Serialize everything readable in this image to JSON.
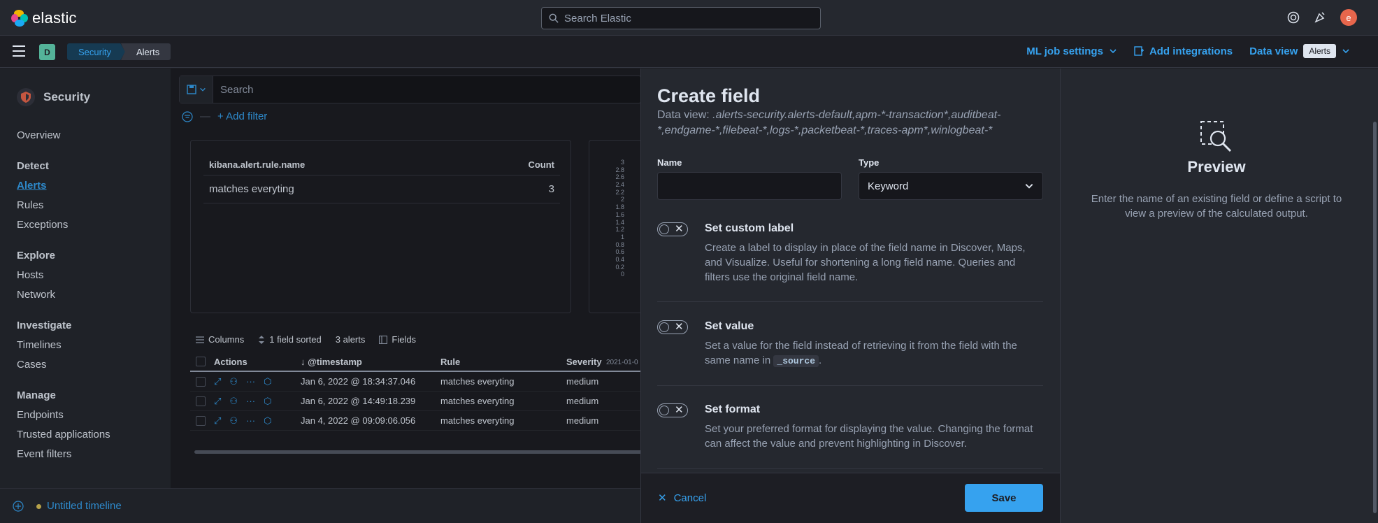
{
  "header": {
    "brand": "elastic",
    "search_placeholder": "Search Elastic",
    "avatar_initial": "e"
  },
  "subheader": {
    "space_initial": "D",
    "breadcrumbs": [
      "Security",
      "Alerts"
    ],
    "ml_job_settings": "ML job settings",
    "add_integrations": "Add integrations",
    "data_view_label": "Data view",
    "data_view_value": "Alerts"
  },
  "sidebar": {
    "title": "Security",
    "overview": "Overview",
    "groups": {
      "detect": "Detect",
      "explore": "Explore",
      "investigate": "Investigate",
      "manage": "Manage"
    },
    "items": {
      "alerts": "Alerts",
      "rules": "Rules",
      "exceptions": "Exceptions",
      "hosts": "Hosts",
      "network": "Network",
      "timelines": "Timelines",
      "cases": "Cases",
      "endpoints": "Endpoints",
      "trusted_applications": "Trusted applications",
      "event_filters": "Event filters"
    }
  },
  "main": {
    "search_placeholder": "Search",
    "add_filter": "+ Add filter",
    "count_table": {
      "col_name": "kibana.alert.rule.name",
      "col_count": "Count",
      "rows": [
        {
          "name": "matches everyting",
          "count": "3"
        }
      ]
    },
    "y_ticks": [
      "3",
      "2.8",
      "2.6",
      "2.4",
      "2.2",
      "2",
      "1.8",
      "1.6",
      "1.4",
      "1.2",
      "1",
      "0.8",
      "0.6",
      "0.4",
      "0.2",
      "0"
    ],
    "x_tick": "2021-01-0",
    "toolbar": {
      "columns": "Columns",
      "sorted": "1 field sorted",
      "alerts": "3 alerts",
      "fields": "Fields"
    },
    "table": {
      "headers": {
        "actions": "Actions",
        "timestamp": "@timestamp",
        "rule": "Rule",
        "severity": "Severity"
      },
      "rows": [
        {
          "timestamp": "Jan 6, 2022 @ 18:34:37.046",
          "rule": "matches everyting",
          "severity": "medium"
        },
        {
          "timestamp": "Jan 6, 2022 @ 14:49:18.239",
          "rule": "matches everyting",
          "severity": "medium"
        },
        {
          "timestamp": "Jan 4, 2022 @ 09:09:06.056",
          "rule": "matches everyting",
          "severity": "medium"
        }
      ]
    }
  },
  "timeline": {
    "label": "Untitled timeline"
  },
  "flyout": {
    "title": "Create field",
    "data_view_prefix": "Data view:",
    "data_view_pattern": ".alerts-security.alerts-default,apm-*-transaction*,auditbeat-*,endgame-*,filebeat-*,logs-*,packetbeat-*,traces-apm*,winlogbeat-*",
    "name_label": "Name",
    "name_value": "",
    "type_label": "Type",
    "type_value": "Keyword",
    "custom_label": {
      "title": "Set custom label",
      "desc": "Create a label to display in place of the field name in Discover, Maps, and Visualize. Useful for shortening a long field name. Queries and filters use the original field name."
    },
    "set_value": {
      "title": "Set value",
      "desc_before": "Set a value for the field instead of retrieving it from the field with the same name in",
      "code": "_source",
      "desc_after": "."
    },
    "set_format": {
      "title": "Set format",
      "desc": "Set your preferred format for displaying the value. Changing the format can affect the value and prevent highlighting in Discover."
    },
    "cancel": "Cancel",
    "save": "Save"
  },
  "preview": {
    "title": "Preview",
    "desc": "Enter the name of an existing field or define a script to view a preview of the calculated output."
  },
  "colors": {
    "accent": "#36a2ef",
    "background": "#1d1e24",
    "panel": "#25282f",
    "avatar": "#e7664c",
    "space_badge": "#54b399"
  }
}
